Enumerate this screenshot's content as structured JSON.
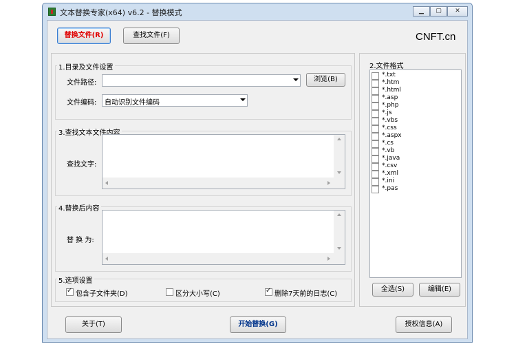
{
  "window": {
    "title": "文本替换专家(x64) v6.2 - 替换模式",
    "controls": [
      "minimize",
      "maximize",
      "close"
    ]
  },
  "toolbar": {
    "replace_label": "替换文件(R)",
    "find_label": "查找文件(F)",
    "brand": "CNFT.cn"
  },
  "section1": {
    "title": "1.目录及文件设置",
    "path_label": "文件路径:",
    "path_value": "",
    "browse_label": "浏览(B)",
    "encoding_label": "文件编码:",
    "encoding_value": "自动识别文件编码"
  },
  "section3": {
    "title": "3.查找文本文件内容",
    "find_label": "查找文字:",
    "find_value": ""
  },
  "section4": {
    "title": "4.替换后内容",
    "replace_label": "替 换 为:",
    "replace_value": ""
  },
  "section5": {
    "title": "5.选项设置",
    "options": [
      {
        "label": "包含子文件夹(D)",
        "checked": true
      },
      {
        "label": "区分大小写(C)",
        "checked": false
      },
      {
        "label": "删除7天前的日志(C)",
        "checked": true
      }
    ]
  },
  "section2": {
    "title": "2.文件格式",
    "formats": [
      "*.txt",
      "*.htm",
      "*.html",
      "*.asp",
      "*.php",
      "*.js",
      "*.vbs",
      "*.css",
      "*.aspx",
      "*.cs",
      "*.vb",
      "*.java",
      "*.csv",
      "*.xml",
      "*.ini",
      "*.pas"
    ],
    "select_all_label": "全选(S)",
    "edit_label": "编辑(E)"
  },
  "footer": {
    "about_label": "关于(T)",
    "start_label": "开始替换(G)",
    "license_label": "授权信息(A)"
  }
}
